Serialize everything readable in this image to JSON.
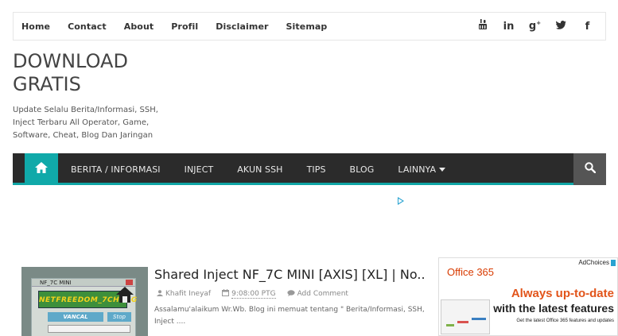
{
  "topnav": {
    "links": [
      "Home",
      "Contact",
      "About",
      "Profil",
      "Disclaimer",
      "Sitemap"
    ],
    "social_icons": [
      "youtube-icon",
      "linkedin-icon",
      "google-plus-icon",
      "twitter-icon",
      "facebook-icon"
    ]
  },
  "header": {
    "title": "DOWNLOAD GRATIS",
    "description": "Update Selalu Berita/Informasi, SSH, Inject Terbaru All Operator, Game, Software, Cheat, Blog Dan Jaringan"
  },
  "mainnav": {
    "items": [
      "BERITA / INFORMASI",
      "INJECT",
      "AKUN SSH",
      "TIPS",
      "BLOG",
      "LAINNYA"
    ],
    "accent": "#10a9a9"
  },
  "post": {
    "title": "Shared Inject NF_7C MINI [AXIS] [XL] | No..",
    "author": "Khafit Ineyaf",
    "time": "9:08:00 PTG",
    "comment": "Add Comment",
    "excerpt": "Assalamu'alaikum Wr.Wb.   Blog ini memuat tentang \" Berita/Informasi, SSH, Inject ....",
    "thumb": {
      "title": "NF_7C MINI",
      "logo": "NETFREEDOM_7CHENG",
      "button1": "VANCAL",
      "button2": "Stop"
    }
  },
  "ad": {
    "adchoices": "AdChoices",
    "brand": "Office 365",
    "headline1": "Always up-to-date",
    "headline2": "with the latest features",
    "small": "Get the latest Office 365 features and updates"
  }
}
